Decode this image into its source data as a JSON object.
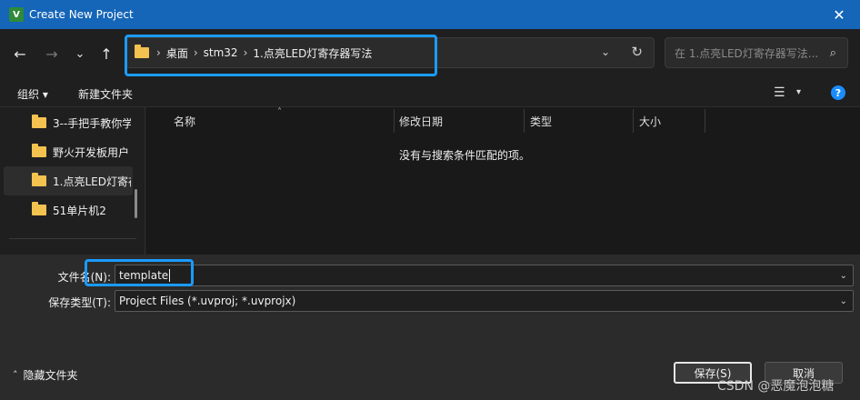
{
  "window": {
    "title": "Create New Project",
    "app_icon_letter": "V",
    "close_glyph": "✕"
  },
  "nav": {
    "back": "←",
    "forward": "→",
    "recent": "⌄",
    "up": "↑"
  },
  "address": {
    "crumbs": [
      "桌面",
      "stm32",
      "1.点亮LED灯寄存器写法"
    ],
    "separator": "›",
    "chevron": "⌄",
    "refresh": "↻"
  },
  "search": {
    "placeholder": "在 1.点亮LED灯寄存器写法...",
    "icon": "⌕"
  },
  "toolbar": {
    "organize": "组织 ▾",
    "new_folder": "新建文件夹",
    "view_icon": "☰",
    "view_caret": "▾",
    "help": "?"
  },
  "sidebar": {
    "items": [
      {
        "label": "3--手把手教你学"
      },
      {
        "label": "野火开发板用户"
      },
      {
        "label": "1.点亮LED灯寄存"
      },
      {
        "label": "51单片机2"
      }
    ]
  },
  "filelist": {
    "columns": [
      "名称",
      "修改日期",
      "类型",
      "大小"
    ],
    "sort_caret": "˄",
    "empty_message": "没有与搜索条件匹配的项。"
  },
  "form": {
    "filename_label": "文件名(N):",
    "filename_value": "template",
    "filetype_label": "保存类型(T):",
    "filetype_value": "Project Files (*.uvproj; *.uvprojx)",
    "chevron": "⌄"
  },
  "footer": {
    "hide_folders": "隐藏文件夹",
    "hide_caret": "˄",
    "save": "保存(S)",
    "cancel": "取消",
    "watermark": "CSDN @恶魔泡泡糖"
  }
}
